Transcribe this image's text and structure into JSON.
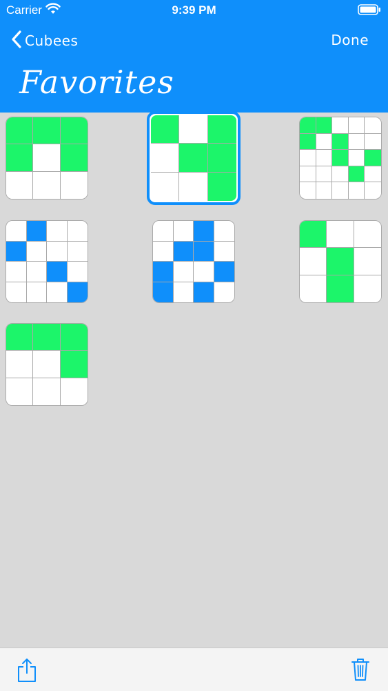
{
  "status_bar": {
    "carrier": "Carrier",
    "time": "9:39 PM"
  },
  "nav": {
    "back_label": "Cubees",
    "done_label": "Done",
    "title": "Favorites"
  },
  "colors": {
    "accent": "#0f8ffb",
    "green": "#1cf56a",
    "blue": "#0f8ffb",
    "background": "#d9d9d9"
  },
  "tiles": [
    {
      "grid": 3,
      "selected": false,
      "color": "green",
      "cells": [
        [
          1,
          1,
          1
        ],
        [
          1,
          0,
          1
        ],
        [
          0,
          0,
          0
        ]
      ]
    },
    {
      "grid": 3,
      "selected": true,
      "color": "green",
      "cells": [
        [
          1,
          0,
          1
        ],
        [
          0,
          1,
          1
        ],
        [
          0,
          0,
          1
        ]
      ]
    },
    {
      "grid": 5,
      "selected": false,
      "color": "green",
      "cells": [
        [
          1,
          1,
          0,
          0,
          0
        ],
        [
          1,
          0,
          1,
          0,
          0
        ],
        [
          0,
          0,
          1,
          0,
          1
        ],
        [
          0,
          0,
          0,
          1,
          0
        ],
        [
          0,
          0,
          0,
          0,
          0
        ]
      ]
    },
    {
      "grid": 4,
      "selected": false,
      "color": "blue",
      "cells": [
        [
          0,
          1,
          0,
          0
        ],
        [
          1,
          0,
          0,
          0
        ],
        [
          0,
          0,
          1,
          0
        ],
        [
          0,
          0,
          0,
          1
        ]
      ]
    },
    {
      "grid": 4,
      "selected": false,
      "color": "blue",
      "cells": [
        [
          0,
          0,
          1,
          0
        ],
        [
          0,
          1,
          1,
          0
        ],
        [
          1,
          0,
          0,
          1
        ],
        [
          1,
          0,
          1,
          0
        ]
      ]
    },
    {
      "grid": 3,
      "selected": false,
      "color": "green",
      "cells": [
        [
          1,
          0,
          0
        ],
        [
          0,
          1,
          0
        ],
        [
          0,
          1,
          0
        ]
      ]
    },
    {
      "grid": 3,
      "selected": false,
      "color": "green",
      "cells": [
        [
          1,
          1,
          1
        ],
        [
          0,
          0,
          1
        ],
        [
          0,
          0,
          0
        ]
      ]
    }
  ],
  "toolbar": {
    "share_icon": "share-icon",
    "trash_icon": "trash-icon"
  }
}
